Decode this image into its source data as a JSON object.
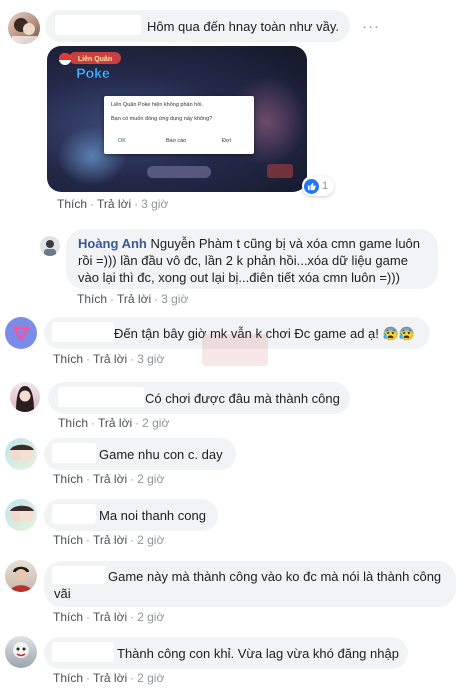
{
  "actions": {
    "like": "Thích",
    "reply": "Trả lời",
    "separator": "·"
  },
  "more_options": "···",
  "comments": [
    {
      "text": "Hôm qua đến hnay toàn như vầy.",
      "time": "3 giờ",
      "reactions": "1"
    },
    {
      "author": "Hoàng Anh",
      "text": "Nguyễn Phàm t cũng bị và xóa cmn game luôn rồi =))) lần đầu vô đc, lần 2 k phản hồi...xóa dữ liệu game vào lại thì đc, xong out lại bị...điên tiết xóa cmn luôn =)))",
      "time": "3 giờ"
    },
    {
      "text": "Đến tận bây giờ mk vẫn k chơi Đc game ad ạ! 😰😰",
      "time": "3 giờ"
    },
    {
      "text": "Có chơi được đâu mà thành công",
      "time": "2 giờ"
    },
    {
      "text": "Game nhu con c. day",
      "time": "2 giờ"
    },
    {
      "text": "Ma noi thanh cong",
      "time": "2 giờ"
    },
    {
      "text": "Game này mà thành công vào ko đc mà nói là thành công vãi",
      "time": "2 giờ"
    },
    {
      "text": "Thành công con khỉ. Vừa lag vừa khó đăng nhập",
      "time": "2 giờ"
    }
  ],
  "screenshot_dialog": {
    "message": "Liên Quân Poke hiện không phản hồi.",
    "question": "Bạn có muốn đóng ứng dụng này không?",
    "ok": "OK",
    "report": "Báo cáo",
    "wait": "Đợi",
    "logo": "Liên Quân Poke"
  },
  "colors": {
    "bubble": "#f2f3f5",
    "name": "#385898",
    "like_blue": "#2078f4",
    "meta": "#90949c"
  }
}
